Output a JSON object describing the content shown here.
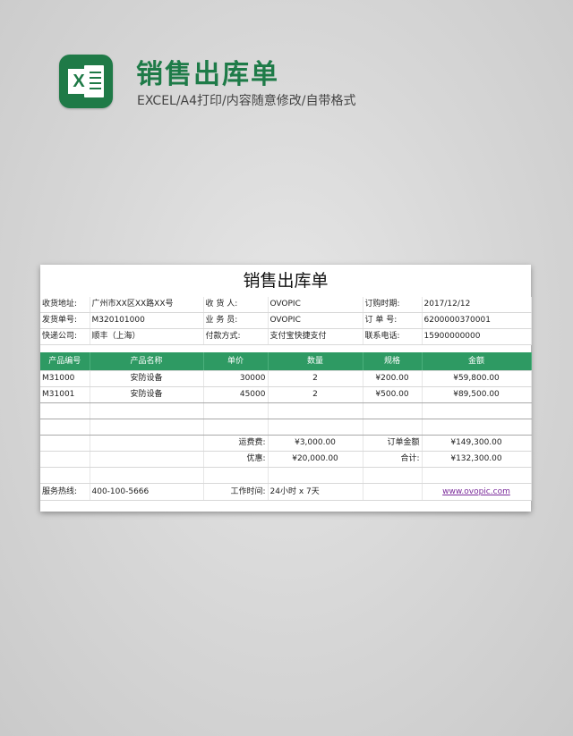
{
  "header": {
    "title": "销售出库单",
    "subtitle": "EXCEL/A4打印/内容随意修改/自带格式"
  },
  "sheet": {
    "title": "销售出库单",
    "info": {
      "row1": {
        "l1": "收货地址:",
        "v1": "广州市XX区XX路XX号",
        "l2": "收 货 人:",
        "v2": "OVOPIC",
        "l3": "订购时期:",
        "v3": "2017/12/12"
      },
      "row2": {
        "l1": "发货单号:",
        "v1": "M320101000",
        "l2": "业 务 员:",
        "v2": "OVOPIC",
        "l3": "订 单 号:",
        "v3": "6200000370001"
      },
      "row3": {
        "l1": "快递公司:",
        "v1": "顺丰（上海）",
        "l2": "付款方式:",
        "v2": "支付宝快捷支付",
        "l3": "联系电话:",
        "v3": "15900000000"
      }
    },
    "columns": [
      "产品编号",
      "产品名称",
      "单价",
      "数量",
      "规格",
      "金额"
    ],
    "rows": [
      {
        "code": "M31000",
        "name": "安防设备",
        "price": "30000",
        "qty": "2",
        "spec": "¥200.00",
        "amount": "¥59,800.00"
      },
      {
        "code": "M31001",
        "name": "安防设备",
        "price": "45000",
        "qty": "2",
        "spec": "¥500.00",
        "amount": "¥89,500.00"
      }
    ],
    "summary": {
      "shipping_label": "运费费:",
      "shipping_value": "¥3,000.00",
      "order_total_label": "订单金额",
      "order_total_value": "¥149,300.00",
      "discount_label": "优惠:",
      "discount_value": "¥20,000.00",
      "total_label": "合计:",
      "total_value": "¥132,300.00"
    },
    "footer": {
      "hotline_label": "服务热线:",
      "hotline_value": "400-100-5666",
      "hours_label": "工作时间:",
      "hours_value": "24小时 x 7天",
      "website": "www.ovopic.com"
    }
  },
  "colors": {
    "accent": "#2e9a63",
    "title_green": "#1e7b48",
    "link": "#7a2a9a"
  },
  "icons": {
    "app": "excel-icon"
  }
}
